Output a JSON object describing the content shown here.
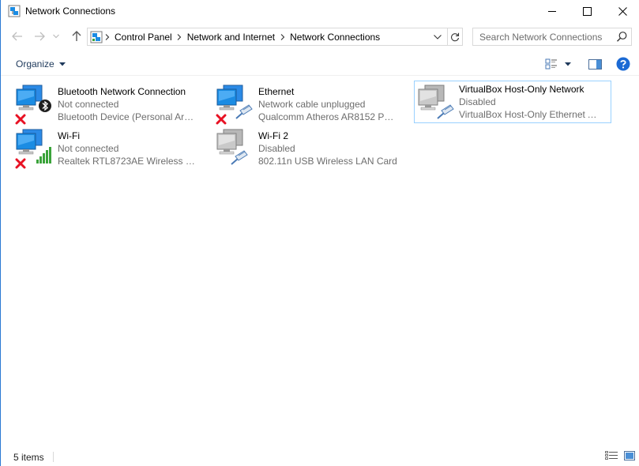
{
  "window": {
    "title": "Network Connections",
    "accent": "#2b79d3"
  },
  "nav": {
    "back": "Back",
    "forward": "Forward",
    "up": "Up"
  },
  "address": {
    "crumbs": [
      "Control Panel",
      "Network and Internet",
      "Network Connections"
    ]
  },
  "search": {
    "placeholder": "Search Network Connections"
  },
  "toolbar": {
    "organize_label": "Organize"
  },
  "items": [
    {
      "name": "Bluetooth Network Connection",
      "status": "Not connected",
      "device": "Bluetooth Device (Personal Area ...",
      "icon": "bluetooth-adapter-icon",
      "badge": "disconnected-x-icon"
    },
    {
      "name": "Ethernet",
      "status": "Network cable unplugged",
      "device": "Qualcomm Atheros AR8152 PCI-E...",
      "icon": "ethernet-adapter-icon",
      "badge": "disconnected-x-icon"
    },
    {
      "name": "VirtualBox Host-Only Network",
      "status": "Disabled",
      "device": "VirtualBox Host-Only Ethernet Ad...",
      "icon": "disabled-adapter-icon",
      "selected": true
    },
    {
      "name": "Wi-Fi",
      "status": "Not connected",
      "device": "Realtek RTL8723AE Wireless LAN ...",
      "icon": "wifi-adapter-icon",
      "badge": "disconnected-x-icon"
    },
    {
      "name": "Wi-Fi 2",
      "status": "Disabled",
      "device": "802.11n USB Wireless LAN Card",
      "icon": "disabled-adapter-icon"
    }
  ],
  "statusbar": {
    "count": "5 items"
  },
  "colors": {
    "link_blue": "#1e395b",
    "monitor_blue": "#1b8ce3",
    "disconnected_red": "#e81123",
    "signal_green": "#3aa33a",
    "help_blue": "#1c6ad4",
    "selection_border": "#99d1ff"
  }
}
